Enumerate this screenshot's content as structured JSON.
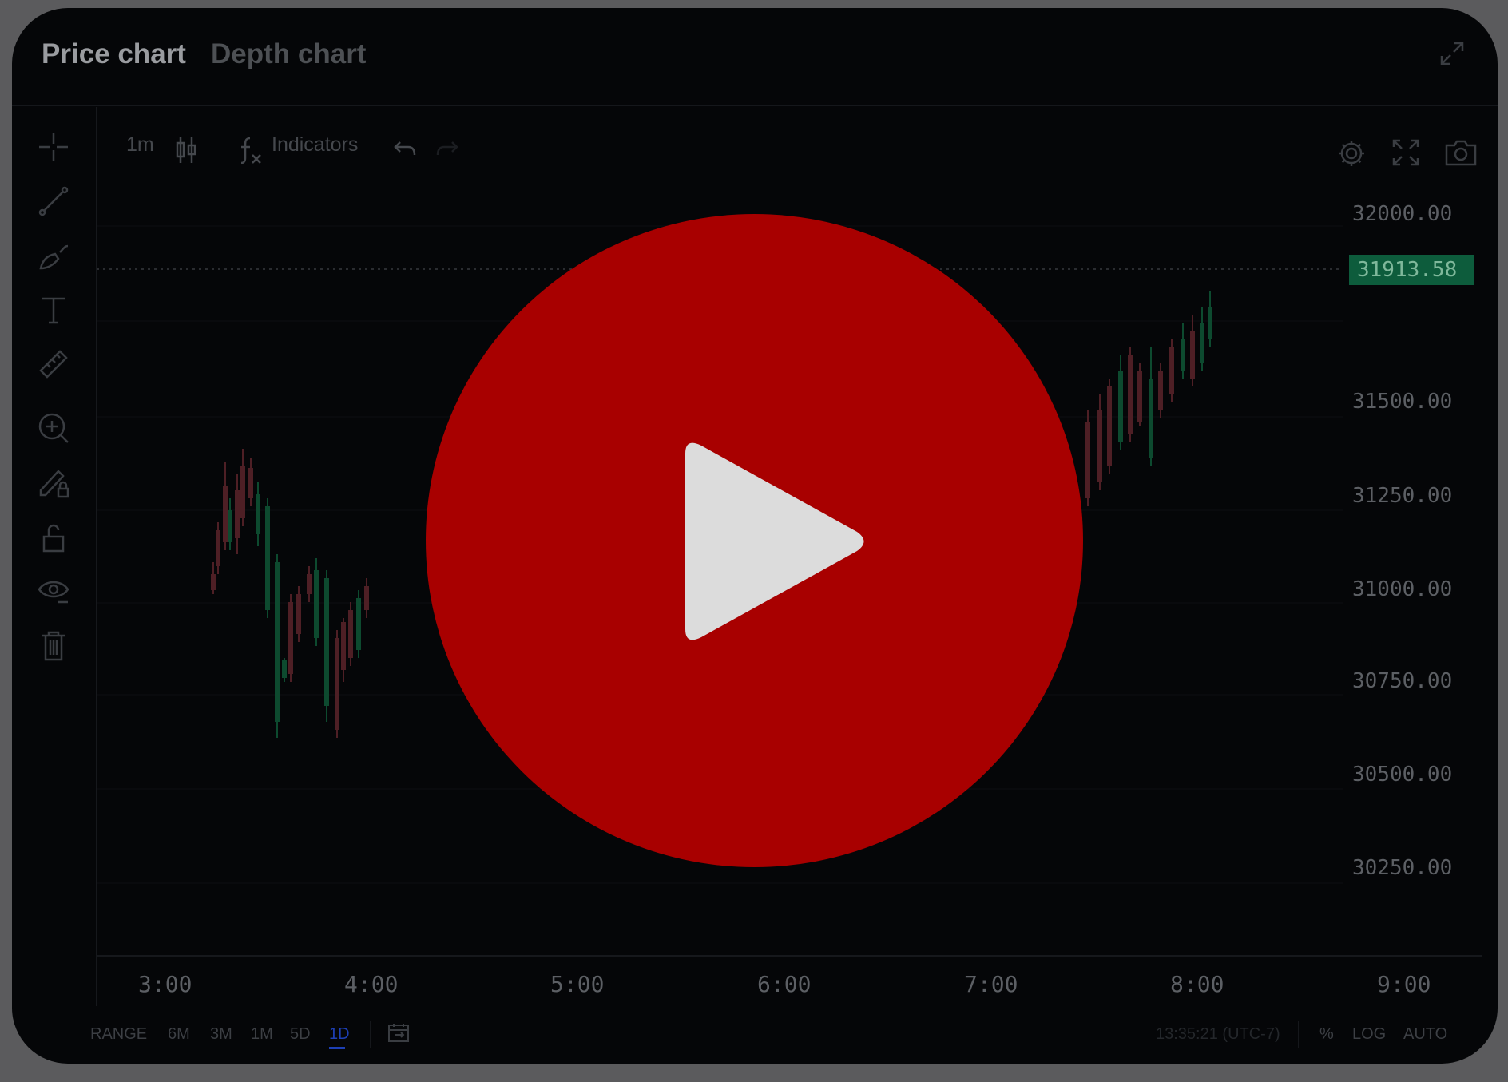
{
  "tabs": {
    "price_chart": "Price chart",
    "depth_chart": "Depth chart"
  },
  "toolbar": {
    "interval": "1m",
    "indicators": "Indicators"
  },
  "price_axis": [
    "32000.00",
    "31500.00",
    "31250.00",
    "31000.00",
    "30750.00",
    "30500.00",
    "30250.00"
  ],
  "current_price": "31913.58",
  "time_axis": [
    "3:00",
    "4:00",
    "5:00",
    "6:00",
    "7:00",
    "8:00",
    "9:00"
  ],
  "range": {
    "label": "RANGE",
    "options": [
      "6M",
      "3M",
      "1M",
      "5D",
      "1D"
    ],
    "selected": "1D"
  },
  "footer": {
    "clock": "13:35:21 (UTC-7)",
    "percent": "%",
    "log": "LOG",
    "auto": "AUTO"
  },
  "colors": {
    "up": "#0d4a2f",
    "down": "#4e1f25",
    "accent": "#1d3fb5",
    "price_tag": "#0d5c3c",
    "play": "#a80000"
  },
  "icons": [
    "crosshair-icon",
    "trend-line-icon",
    "brush-icon",
    "text-icon",
    "ruler-icon",
    "zoom-in-icon",
    "lock-pencil-icon",
    "unlock-icon",
    "eye-icon",
    "trash-icon",
    "candles-icon",
    "fx-icon",
    "undo-icon",
    "redo-icon",
    "settings-icon",
    "fullscreen-icon",
    "camera-icon",
    "calendar-icon",
    "play-icon"
  ]
}
